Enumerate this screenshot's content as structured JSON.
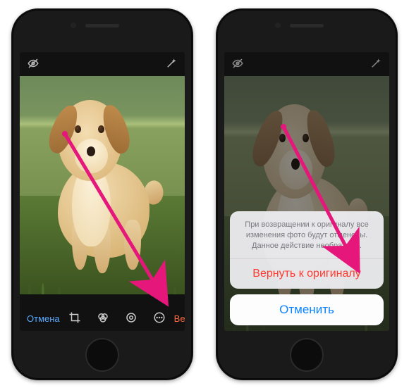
{
  "left": {
    "topbar": {
      "visibility_icon": "eye-off-icon",
      "wand_icon": "magic-wand-icon"
    },
    "bottombar": {
      "cancel": "Отмена",
      "revert": "Вернуть",
      "tools": {
        "crop_icon": "crop-icon",
        "filters_icon": "filters-icon",
        "adjust_icon": "adjust-icon",
        "more_icon": "more-icon"
      }
    }
  },
  "right": {
    "topbar": {
      "visibility_icon": "eye-off-icon",
      "wand_icon": "magic-wand-icon"
    },
    "sheet": {
      "message": "При возвращении к оригиналу все изменения фото будут отменены. Данное действие необратимо.",
      "revert": "Вернуть к оригиналу",
      "cancel": "Отменить"
    }
  },
  "annotation": {
    "color": "#e5177b"
  }
}
